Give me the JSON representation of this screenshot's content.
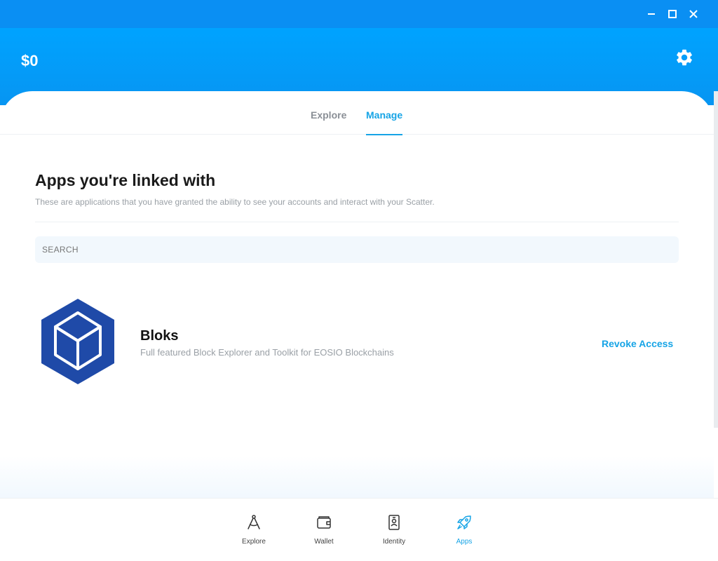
{
  "window": {
    "minimize": "minimize",
    "maximize": "maximize",
    "close": "close"
  },
  "header": {
    "balance": "$0",
    "settings_icon": "gear-icon"
  },
  "tabs": [
    {
      "label": "Explore",
      "active": false
    },
    {
      "label": "Manage",
      "active": true
    }
  ],
  "main": {
    "title": "Apps you're linked with",
    "subtitle": "These are applications that you have granted the ability to see your accounts and interact with your Scatter.",
    "search": {
      "placeholder": "SEARCH",
      "value": ""
    }
  },
  "apps": [
    {
      "name": "Bloks",
      "description": "Full featured Block Explorer and Toolkit for EOSIO Blockchains",
      "action_label": "Revoke Access",
      "icon": "bloks-cube-logo"
    }
  ],
  "nav": [
    {
      "label": "Explore",
      "icon": "compass-drafting-icon",
      "active": false
    },
    {
      "label": "Wallet",
      "icon": "wallet-icon",
      "active": false
    },
    {
      "label": "Identity",
      "icon": "id-badge-icon",
      "active": false
    },
    {
      "label": "Apps",
      "icon": "rocket-icon",
      "active": true
    }
  ],
  "colors": {
    "titlebar": "#0a8ff3",
    "header": "#00a3ff",
    "accent": "#16a4e6",
    "logo": "#1f4aa8"
  }
}
